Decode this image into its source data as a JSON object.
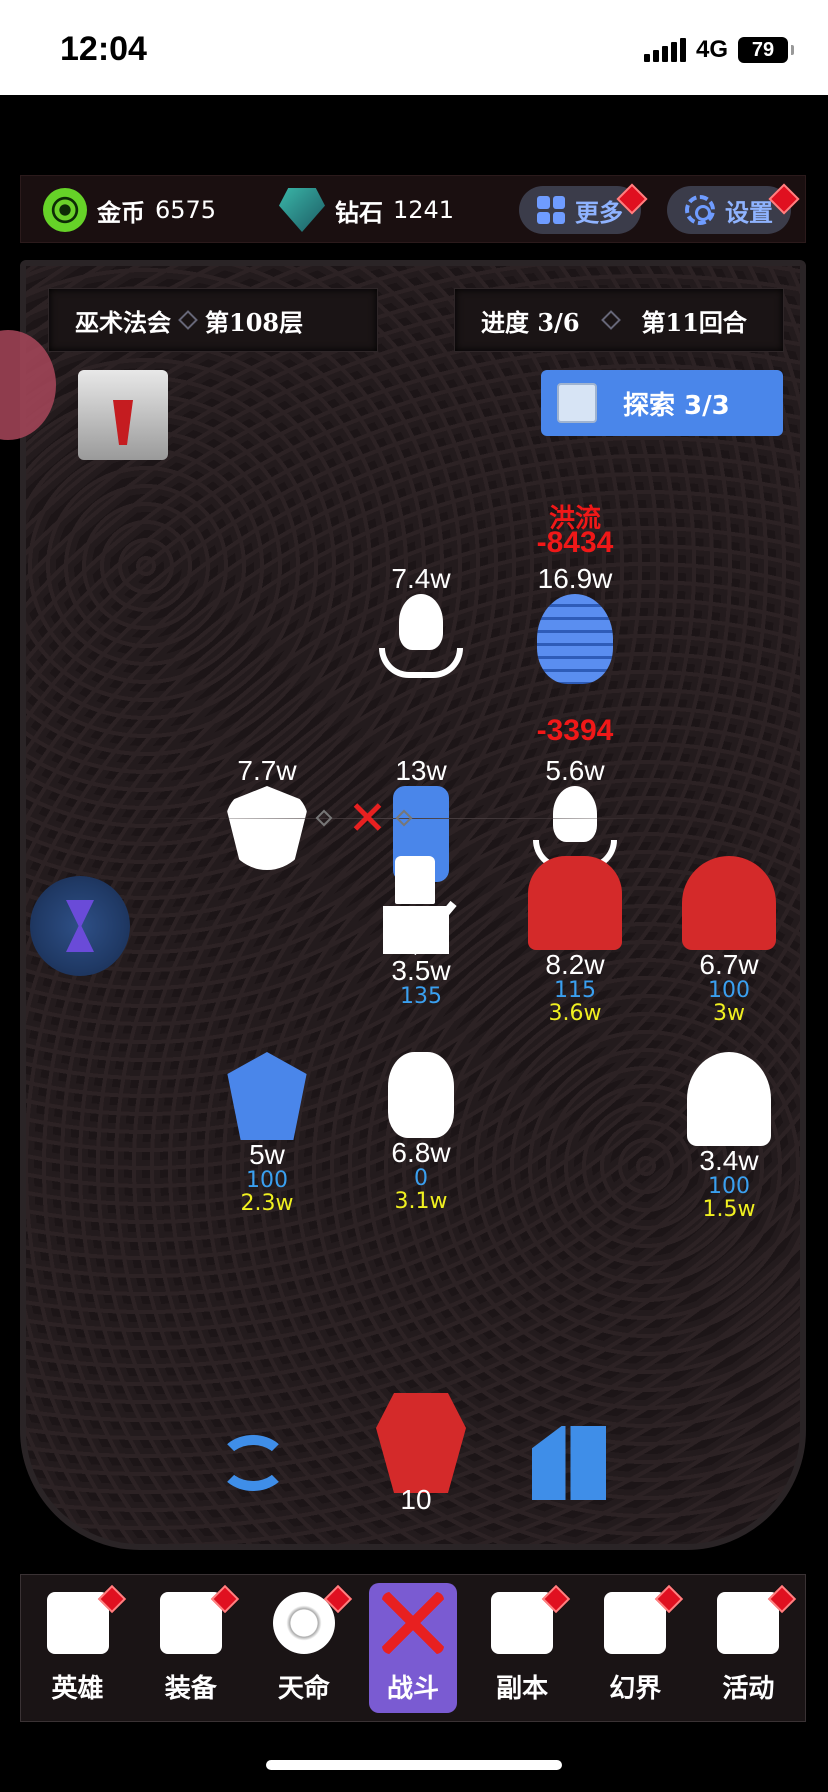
{
  "status_bar": {
    "time": "12:04",
    "network": "4G",
    "battery": "79"
  },
  "resources": {
    "gold": {
      "label": "金币",
      "value": "6575",
      "icon": "gold-coin-icon"
    },
    "diamond": {
      "label": "钻石",
      "value": "1241",
      "icon": "diamond-gem-icon"
    },
    "more_button": "更多",
    "settings_button": "设置"
  },
  "board": {
    "location": "巫术法会",
    "floor": "第108层",
    "progress": "进度 3/6",
    "round": "第11回合",
    "explore_button": "探索 3/3"
  },
  "enemies": [
    {
      "name": "octopus-enemy-top",
      "hp": "7.4w"
    },
    {
      "name": "mummy-enemy",
      "hp": "16.9w",
      "damage": "-8434",
      "status": "洪流"
    },
    {
      "name": "vampire-enemy",
      "hp": "7.7w"
    },
    {
      "name": "zombie-enemy",
      "hp": "13w"
    },
    {
      "name": "octopus-enemy-bottom",
      "hp": "5.6w",
      "damage": "-3394"
    }
  ],
  "heroes": [
    {
      "name": "knight-hero",
      "hp": "3.5w",
      "stat": "135",
      "output": ""
    },
    {
      "name": "pharaoh-hero",
      "hp": "8.2w",
      "stat": "115",
      "output": "3.6w"
    },
    {
      "name": "brute-hero",
      "hp": "6.7w",
      "stat": "100",
      "output": "3w"
    },
    {
      "name": "pirate-hero",
      "hp": "5w",
      "stat": "100",
      "output": "2.3w"
    },
    {
      "name": "cyborg-hero",
      "hp": "6.8w",
      "stat": "0",
      "output": "3.1w"
    },
    {
      "name": "sage-hero",
      "hp": "3.4w",
      "stat": "100",
      "output": "1.5w"
    }
  ],
  "totem_count": "10",
  "nav": [
    {
      "label": "英雄",
      "icon": "hero-skull-icon"
    },
    {
      "label": "装备",
      "icon": "armor-icon"
    },
    {
      "label": "天命",
      "icon": "destiny-seal-icon"
    },
    {
      "label": "战斗",
      "icon": "crossed-swords-icon"
    },
    {
      "label": "副本",
      "icon": "castle-icon"
    },
    {
      "label": "幻界",
      "icon": "gate-icon"
    },
    {
      "label": "活动",
      "icon": "scroll-icon"
    }
  ],
  "colors": {
    "accent_blue": "#4a86ea",
    "damage_red": "#f01818",
    "stat_blue": "#3aa0f0",
    "output_yellow": "#f0f020",
    "active_tab": "#7a5bd2"
  }
}
